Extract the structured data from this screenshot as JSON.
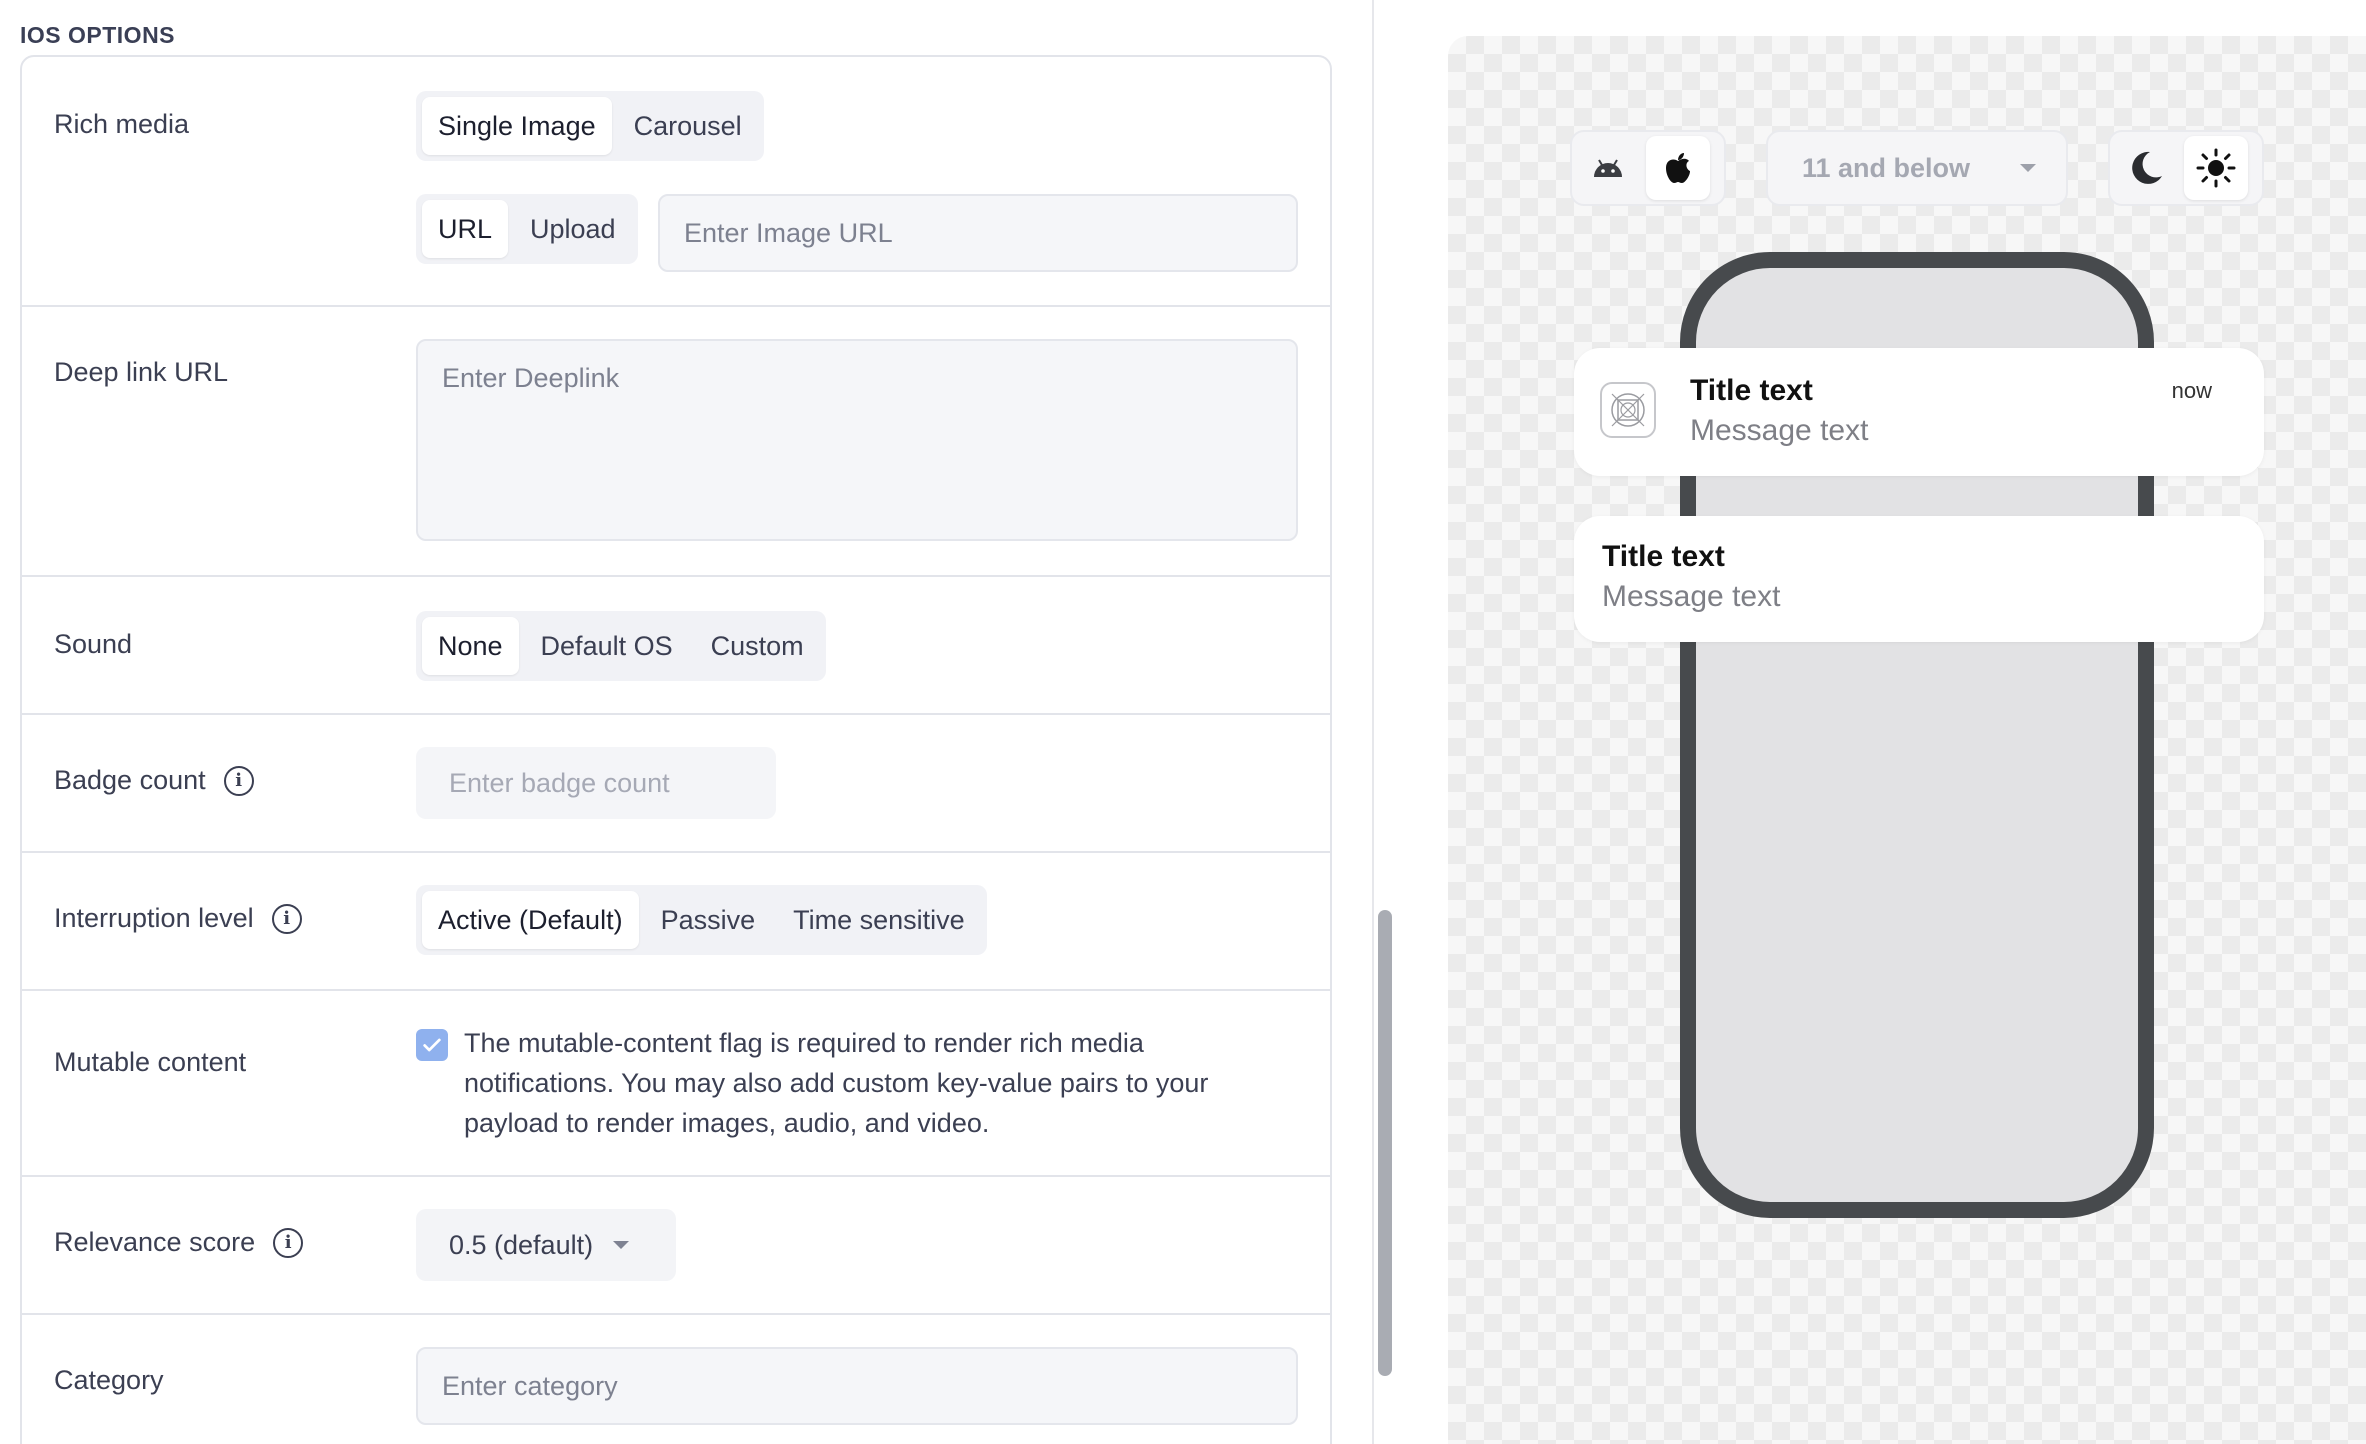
{
  "section_title": "IOS OPTIONS",
  "rows": {
    "rich_media": {
      "label": "Rich media",
      "type_options": [
        "Single Image",
        "Carousel"
      ],
      "type_selected": "Single Image",
      "source_options": [
        "URL",
        "Upload"
      ],
      "source_selected": "URL",
      "url_placeholder": "Enter Image URL"
    },
    "deep_link": {
      "label": "Deep link URL",
      "placeholder": "Enter Deeplink"
    },
    "sound": {
      "label": "Sound",
      "options": [
        "None",
        "Default OS",
        "Custom"
      ],
      "selected": "None"
    },
    "badge": {
      "label": "Badge count",
      "placeholder": "Enter badge count"
    },
    "interruption": {
      "label": "Interruption level",
      "options": [
        "Active (Default)",
        "Passive",
        "Time sensitive"
      ],
      "selected": "Active (Default)"
    },
    "mutable": {
      "label": "Mutable content",
      "checked": true,
      "description": "The mutable-content flag is required to render rich media notifications. You may also add custom key-value pairs to your payload to render images, audio, and video."
    },
    "relevance": {
      "label": "Relevance score",
      "value": "0.5 (default)"
    },
    "category": {
      "label": "Category",
      "placeholder": "Enter category"
    }
  },
  "preview": {
    "platforms": [
      "android-icon",
      "apple-icon"
    ],
    "platform_selected": "apple-icon",
    "version": "11 and below",
    "themes": [
      "moon-icon",
      "sun-icon"
    ],
    "theme_selected": "sun-icon",
    "notification_expanded": {
      "title": "Title text",
      "message": "Message text",
      "time": "now"
    },
    "notification_compact": {
      "title": "Title text",
      "message": "Message text"
    }
  },
  "colors": {
    "checkbox": "#8fb1ee",
    "phone_frame": "#474a4d",
    "phone_screen": "#e2e2e4"
  }
}
